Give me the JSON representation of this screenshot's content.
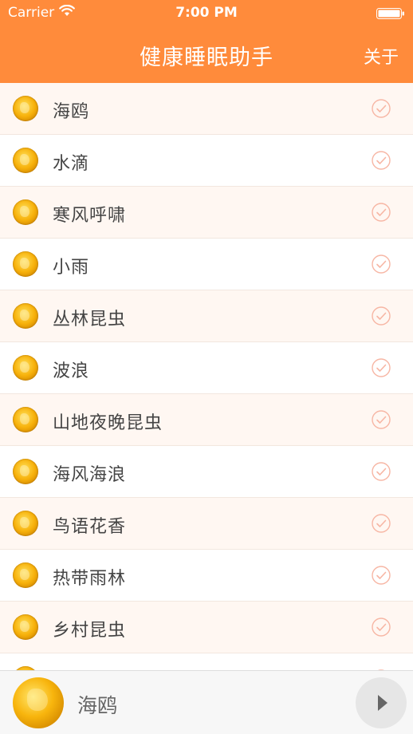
{
  "status_bar": {
    "carrier": "Carrier",
    "time": "7:00 PM"
  },
  "nav": {
    "title": "健康睡眠助手",
    "about_label": "关于"
  },
  "list": {
    "items": [
      {
        "label": "海鸥"
      },
      {
        "label": "水滴"
      },
      {
        "label": "寒风呼啸"
      },
      {
        "label": "小雨"
      },
      {
        "label": "丛林昆虫"
      },
      {
        "label": "波浪"
      },
      {
        "label": "山地夜晚昆虫"
      },
      {
        "label": "海风海浪"
      },
      {
        "label": "鸟语花香"
      },
      {
        "label": "热带雨林"
      },
      {
        "label": "乡村昆虫"
      },
      {
        "label": ""
      }
    ]
  },
  "player": {
    "now_playing": "海鸥"
  },
  "colors": {
    "accent": "#ff8b3b",
    "row_alt": "#fff7f2",
    "check": "#f7b6a4"
  },
  "icons": {
    "wifi": "wifi-icon",
    "battery": "battery-icon",
    "check": "check-circle-icon",
    "play": "play-icon",
    "thumb": "gold-ball-icon"
  }
}
